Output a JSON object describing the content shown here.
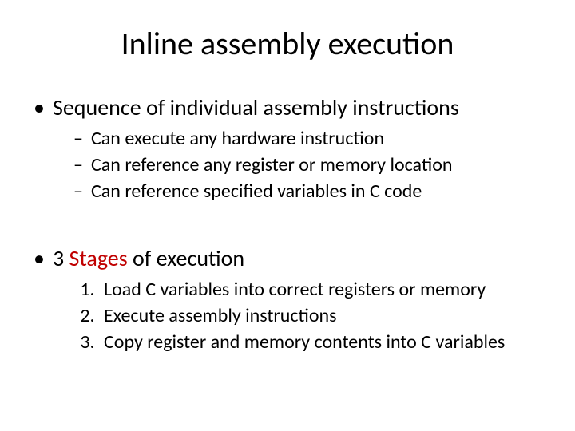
{
  "title": "Inline assembly execution",
  "bullets": [
    {
      "text": "Sequence of individual assembly instructions",
      "sub_dash": [
        "Can execute any hardware instruction",
        "Can reference any register or memory location",
        "Can reference specified variables in C code"
      ]
    },
    {
      "text_prefix": "3 ",
      "text_red": "Stages",
      "text_suffix": " of execution",
      "sub_num": [
        "Load C variables into correct registers or memory",
        "Execute assembly instructions",
        "Copy register and memory contents into C variables"
      ]
    }
  ]
}
